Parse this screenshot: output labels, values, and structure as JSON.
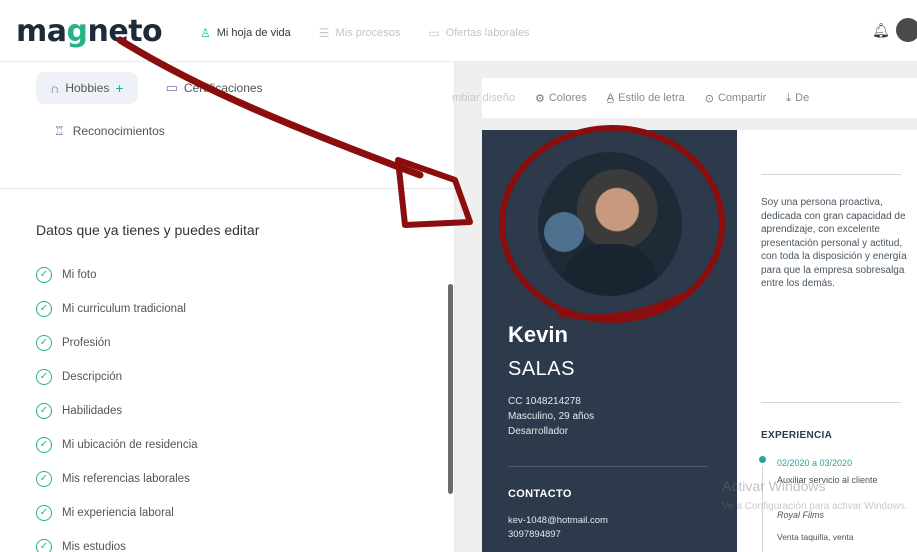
{
  "brand": {
    "logo_text_a": "ma",
    "logo_text_g": "g",
    "logo_text_b": "neto"
  },
  "topnav": {
    "items": [
      {
        "label": "Mi hoja de vida",
        "icon": "user-icon"
      },
      {
        "label": "Mis procesos",
        "icon": "list-icon"
      },
      {
        "label": "Ofertas laborales",
        "icon": "briefcase-icon"
      }
    ]
  },
  "sections": {
    "hobbies": "Hobbies",
    "certificaciones": "Certificaciones",
    "reconocimientos": "Reconocimientos"
  },
  "editable": {
    "title": "Datos que ya tienes y puedes editar",
    "items": [
      "Mi foto",
      "Mi curriculum tradicional",
      "Profesión",
      "Descripción",
      "Habilidades",
      "Mi ubicación de residencia",
      "Mis referencias laborales",
      "Mi experiencia laboral",
      "Mis estudios"
    ]
  },
  "toolbar": {
    "ghost": "mbiar diseño",
    "colores": "Colores",
    "estilo": "Estilo de letra",
    "compartir": "Compartir",
    "descargar": "De"
  },
  "resume": {
    "first_name": "Kevin",
    "last_name": "SALAS",
    "cc": "CC 1048214278",
    "gender_age": "Masculino, 29 años",
    "role": "Desarrollador",
    "contact_title": "CONTACTO",
    "email": "kev-1048@hotmail.com",
    "phone": "3097894897",
    "about": "Soy una persona proactiva, dedicada con gran capacidad de aprendizaje, con excelente presentación personal y actitud, con toda la disposición y energía para que la empresa sobresalga entre los demás.",
    "experience_title": "EXPERIENCIA",
    "exp_date": "02/2020 a 03/2020",
    "exp_role": "Auxiliar servicio al cliente",
    "exp_company": "Royal Films",
    "exp_desc": "Venta taquilla, venta"
  },
  "watermark": {
    "title": "Activar Windows",
    "subtitle": "Ve a Configuración para activar Windows."
  },
  "colors": {
    "brand_green": "#27b38a",
    "resume_navy": "#2c3a4b",
    "annotation_red": "#8b0d0d"
  }
}
